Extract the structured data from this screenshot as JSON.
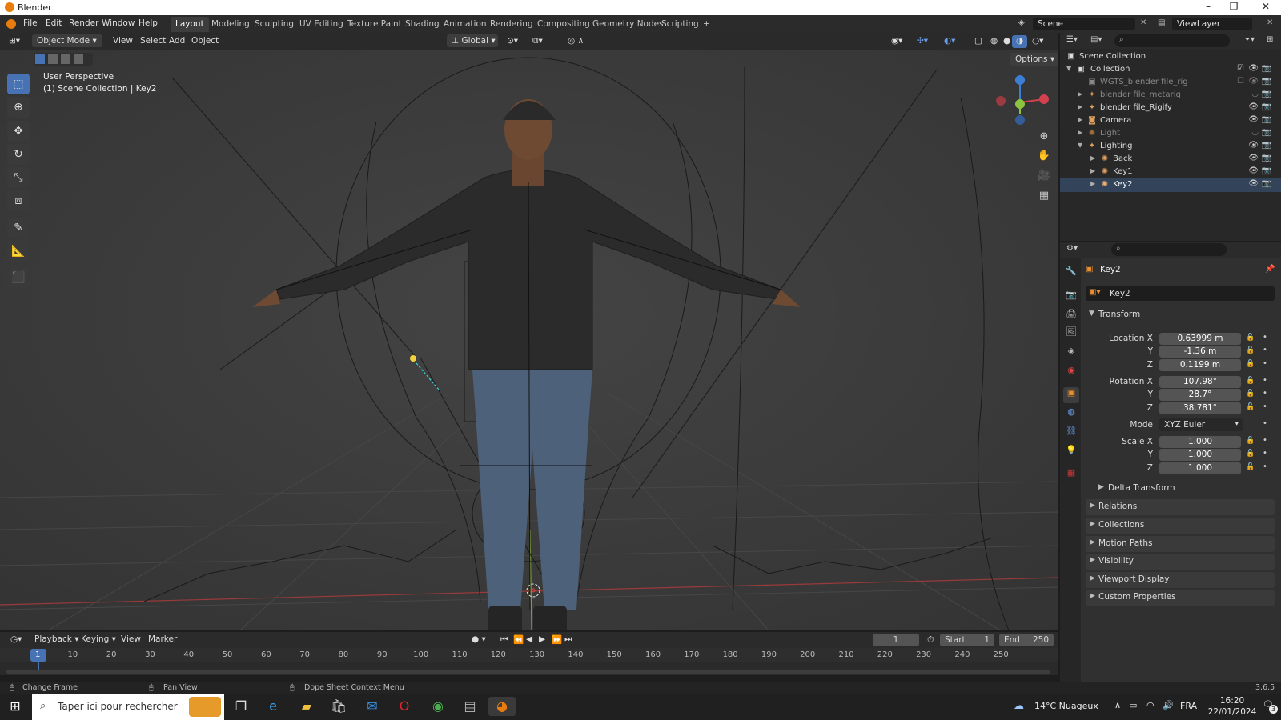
{
  "titlebar": {
    "title": "Blender",
    "minimize": "–",
    "maximize": "❐",
    "close": "✕"
  },
  "menus": [
    "File",
    "Edit",
    "Render",
    "Window",
    "Help"
  ],
  "workspaces": [
    "Layout",
    "Modeling",
    "Sculpting",
    "UV Editing",
    "Texture Paint",
    "Shading",
    "Animation",
    "Rendering",
    "Compositing",
    "Geometry Nodes",
    "Scripting",
    "+"
  ],
  "scene": {
    "name": "Scene",
    "view_layer": "ViewLayer"
  },
  "viewport_header": {
    "mode": "Object Mode",
    "menus": [
      "View",
      "Select",
      "Add",
      "Object"
    ],
    "transform_orientation": "Global",
    "options": "Options"
  },
  "viewport": {
    "perspective": "User Perspective",
    "context": "(1) Scene Collection | Key2"
  },
  "outliner": {
    "rows": [
      {
        "label": "Scene Collection",
        "icon": "scene-collection-icon"
      },
      {
        "label": "Collection",
        "icon": "collection-icon"
      },
      {
        "label": "WGTS_blender file_rig",
        "icon": "collection-icon"
      },
      {
        "label": "blender file_metarig",
        "icon": "armature-icon"
      },
      {
        "label": "blender file_Rigify",
        "icon": "armature-icon"
      },
      {
        "label": "Camera",
        "icon": "camera-icon"
      },
      {
        "label": "Light",
        "icon": "light-icon"
      },
      {
        "label": "Lighting",
        "icon": "armature-icon"
      },
      {
        "label": "Back",
        "icon": "light-icon"
      },
      {
        "label": "Key1",
        "icon": "light-icon"
      },
      {
        "label": "Key2",
        "icon": "light-icon"
      }
    ]
  },
  "properties": {
    "object_name": "Key2",
    "object_field": "Key2",
    "transform_title": "Transform",
    "location": {
      "label": "Location X",
      "x": "0.63999 m",
      "y": "-1.36 m",
      "z": "0.1199 m"
    },
    "rotation": {
      "label": "Rotation X",
      "x": "107.98°",
      "y": "28.7°",
      "z": "38.781°"
    },
    "mode": {
      "label": "Mode",
      "value": "XYZ Euler"
    },
    "scale": {
      "label": "Scale X",
      "x": "1.000",
      "y": "1.000",
      "z": "1.000"
    },
    "axis_y": "Y",
    "axis_z": "Z",
    "sections": [
      "Delta Transform",
      "Relations",
      "Collections",
      "Motion Paths",
      "Visibility",
      "Viewport Display",
      "Custom Properties"
    ]
  },
  "timeline": {
    "menus": [
      "Playback",
      "Keying",
      "View",
      "Marker"
    ],
    "current_frame": "1",
    "start_label": "Start",
    "start": "1",
    "end_label": "End",
    "end": "250",
    "ticks": [
      "1",
      "10",
      "20",
      "30",
      "40",
      "50",
      "60",
      "70",
      "80",
      "90",
      "100",
      "110",
      "120",
      "130",
      "140",
      "150",
      "160",
      "170",
      "180",
      "190",
      "200",
      "210",
      "220",
      "230",
      "240",
      "250"
    ]
  },
  "statusbar": {
    "left": "Change Frame",
    "middle": "Pan View",
    "right": "Dope Sheet Context Menu",
    "version": "3.6.5"
  },
  "taskbar": {
    "search_placeholder": "Taper ici pour rechercher",
    "weather": "14°C  Nuageux",
    "lang": "FRA",
    "time": "16:20",
    "date": "22/01/2024",
    "notif": "3"
  },
  "colors": {
    "accent": "#4772b3",
    "blender_orange": "#e87d0d",
    "axis_x": "#d2414d",
    "axis_y": "#8bc53f",
    "axis_z": "#3c7ed6"
  }
}
